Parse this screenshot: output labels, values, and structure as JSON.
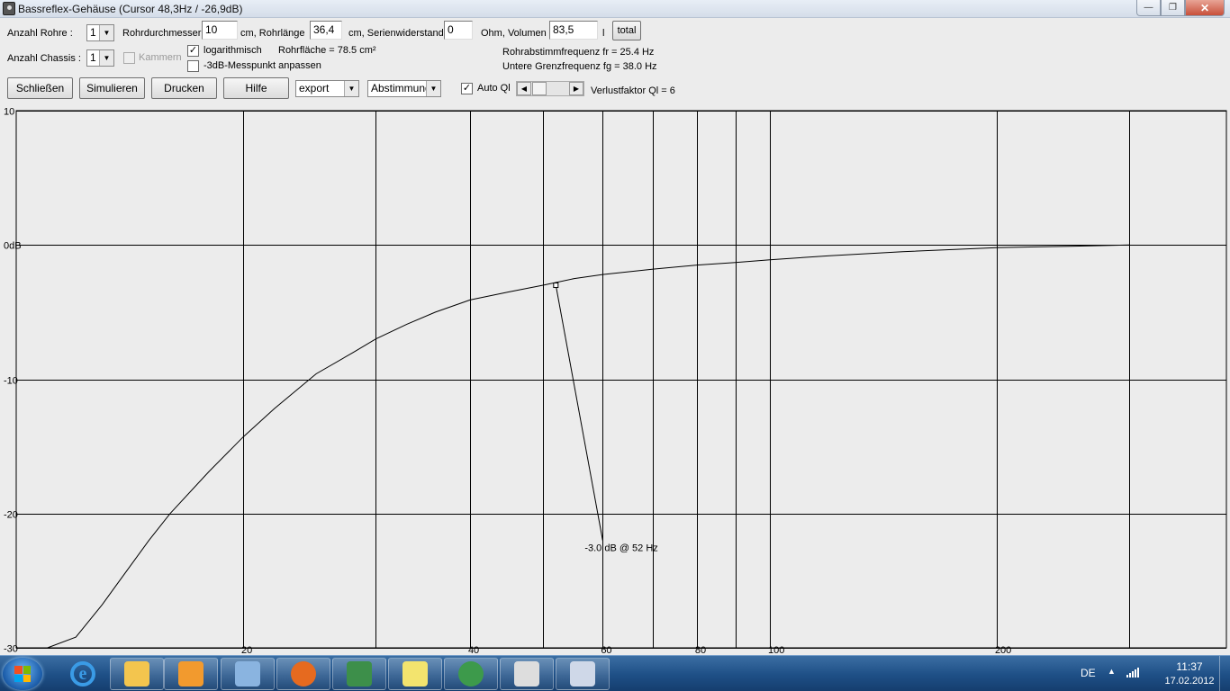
{
  "window": {
    "title": "Bassreflex-Gehäuse (Cursor 48,3Hz / -26,9dB)",
    "btn_min": "—",
    "btn_max": "❐",
    "btn_close": "✕"
  },
  "row1": {
    "anzahl_rohre_label": "Anzahl Rohre :",
    "anzahl_rohre_value": "1",
    "rohrdurchmesser_label": "Rohrdurchmesser",
    "rohrdurchmesser_value": "10",
    "rohrlaenge_label": "cm, Rohrlänge",
    "rohrlaenge_value": "36,4",
    "serienwiderstand_label": "cm, Serienwiderstand",
    "serienwiderstand_value": "0",
    "volumen_label": "Ohm, Volumen",
    "volumen_value": "83,5",
    "volumen_unit": "l",
    "total_label": "total"
  },
  "row2": {
    "anzahl_chassis_label": "Anzahl Chassis :",
    "anzahl_chassis_value": "1",
    "kammern_label": "Kammern",
    "logarithmisch_label": "logarithmisch",
    "logarithmisch_checked": "✓",
    "rohrflaeche": "Rohrfläche = 78.5 cm²",
    "messpunkt_label": "-3dB-Messpunkt anpassen",
    "rohrabstimmfrequenz": "Rohrabstimmfrequenz fr = 25.4 Hz",
    "grenzfrequenz": "Untere Grenzfrequenz fg = 38.0 Hz"
  },
  "row3": {
    "schliessen": "Schließen",
    "simulieren": "Simulieren",
    "drucken": "Drucken",
    "hilfe": "Hilfe",
    "export_value": "export",
    "abstimmung_value": "Abstimmung",
    "auto_ql_label": "Auto Ql",
    "auto_ql_checked": "✓",
    "verlustfaktor": "Verlustfaktor Ql = 6"
  },
  "chart_data": {
    "type": "line",
    "title": "",
    "xlabel": "",
    "ylabel": "",
    "x_scale": "log",
    "y_ticks": [
      "10",
      "0dB",
      "-10",
      "-20",
      "-30"
    ],
    "y_tick_values": [
      10,
      0,
      -10,
      -20,
      -30
    ],
    "ylim": [
      -30,
      10
    ],
    "x_tick_labels": [
      "20",
      "40",
      "60",
      "80",
      "100",
      "200"
    ],
    "x_tick_values": [
      20,
      40,
      60,
      80,
      100,
      200
    ],
    "grid": true,
    "series": [
      {
        "x": [
          10,
          11,
          12,
          13,
          14,
          15,
          16,
          18,
          20,
          22,
          25,
          28,
          30,
          33,
          36,
          40,
          45,
          50,
          55,
          60,
          70,
          80,
          90,
          100,
          120,
          150,
          200,
          250,
          300
        ],
        "y": [
          -30,
          -30,
          -29.2,
          -26.8,
          -24.3,
          -22,
          -20,
          -16.9,
          -14.3,
          -12.2,
          -9.6,
          -8,
          -7,
          -5.9,
          -5,
          -4.1,
          -3.5,
          -3,
          -2.5,
          -2.2,
          -1.8,
          -1.5,
          -1.3,
          -1.1,
          -0.8,
          -0.5,
          -0.2,
          -0.1,
          0
        ]
      }
    ],
    "marker": {
      "x": 52,
      "y": -3.0
    },
    "annotation": {
      "text": "-3.0 dB @  52 Hz",
      "x": 60,
      "y": -22
    }
  },
  "taskbar": {
    "items": [
      {
        "name": "explorer-icon",
        "color": "#f3c54e"
      },
      {
        "name": "media-player-icon",
        "color": "#f29a2e"
      },
      {
        "name": "control-panel-icon",
        "color": "#8ab4e0"
      },
      {
        "name": "firefox-icon",
        "color": "#e66a1f"
      },
      {
        "name": "task-manager-icon",
        "color": "#3d8f4a"
      },
      {
        "name": "sticky-notes-icon",
        "color": "#f3e46e"
      },
      {
        "name": "chrome-icon",
        "color": "#3d9a4b"
      },
      {
        "name": "speaker-app-icon",
        "color": "#dddddd"
      },
      {
        "name": "paint-icon",
        "color": "#cfd8e8"
      }
    ],
    "lang": "DE",
    "time": "11:37",
    "date": "17.02.2012"
  }
}
